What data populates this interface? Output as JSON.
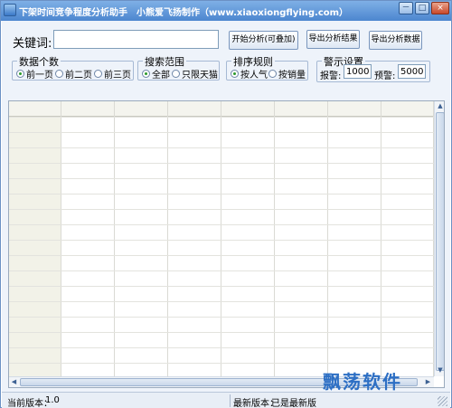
{
  "window": {
    "title": "下架时间竞争程度分析助手",
    "author": "小熊爱飞扬制作（www.xiaoxiongflying.com）",
    "controls": {
      "minimize": "－",
      "maximize": "□",
      "close": "×"
    }
  },
  "keyword": {
    "label": "关键词:",
    "value": "",
    "placeholder": ""
  },
  "buttons": {
    "start": "开始分析(可叠加)",
    "export_result": "导出分析结果",
    "export_data": "导出分析数据"
  },
  "data_count": {
    "title": "数据个数",
    "options": [
      "前一页",
      "前二页",
      "前三页"
    ],
    "selected": 0
  },
  "search_scope": {
    "title": "搜索范围",
    "options": [
      "全部",
      "只限天猫"
    ],
    "selected": 0
  },
  "sort_rule": {
    "title": "排序规则",
    "options": [
      "按人气",
      "按销量"
    ],
    "selected": 0
  },
  "warning": {
    "title": "警示设置",
    "alarm_label": "报警:",
    "alarm_value": "10000",
    "warn_label": "预警:",
    "warn_value": "5000"
  },
  "scrollbar_arrows": {
    "up": "▲",
    "down": "▼",
    "left": "◀",
    "right": "▶"
  },
  "watermark": "飘荡软件",
  "status": {
    "current_version_label": "当前版本：",
    "current_version": "1.0",
    "latest_version_label": "最新版本：",
    "latest_version": "已是最新版"
  },
  "colors": {
    "title_bar": "#4c86cf",
    "window_bg": "#eef3fa",
    "grid_header_bg": "#f4f4ee",
    "selected_radio": "#2b9a2b",
    "watermark": "#2d6fc4"
  }
}
